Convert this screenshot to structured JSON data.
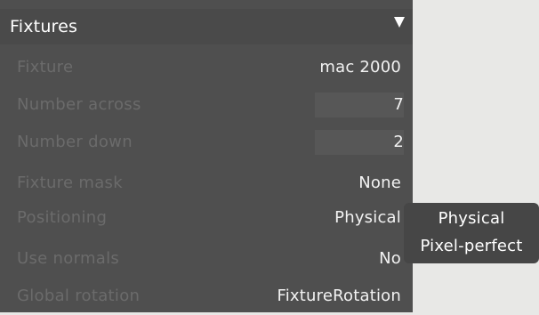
{
  "panel": {
    "title": "Fixtures",
    "collapse_icon": "triangle-down-icon"
  },
  "rows": [
    {
      "label": "Fixture",
      "value": "mac 2000",
      "kind": "dropdown"
    },
    {
      "label": "Number across",
      "value": "7",
      "kind": "number"
    },
    {
      "label": "Number down",
      "value": "2",
      "kind": "number"
    },
    {
      "label": "Fixture mask",
      "value": "None",
      "kind": "dropdown"
    },
    {
      "label": "Positioning",
      "value": "Physical",
      "kind": "dropdown"
    },
    {
      "label": "Use normals",
      "value": "No",
      "kind": "dropdown"
    },
    {
      "label": "Global rotation",
      "value": "FixtureRotation",
      "kind": "dropdown"
    }
  ],
  "positioning_menu": {
    "options": [
      "Physical",
      "Pixel-perfect"
    ]
  },
  "colors": {
    "panel_bg": "#4f4f4f",
    "label_text": "#6b6b6b",
    "value_text": "#f2f2f2",
    "menu_bg": "#464646",
    "page_bg": "#e8e8e6"
  }
}
